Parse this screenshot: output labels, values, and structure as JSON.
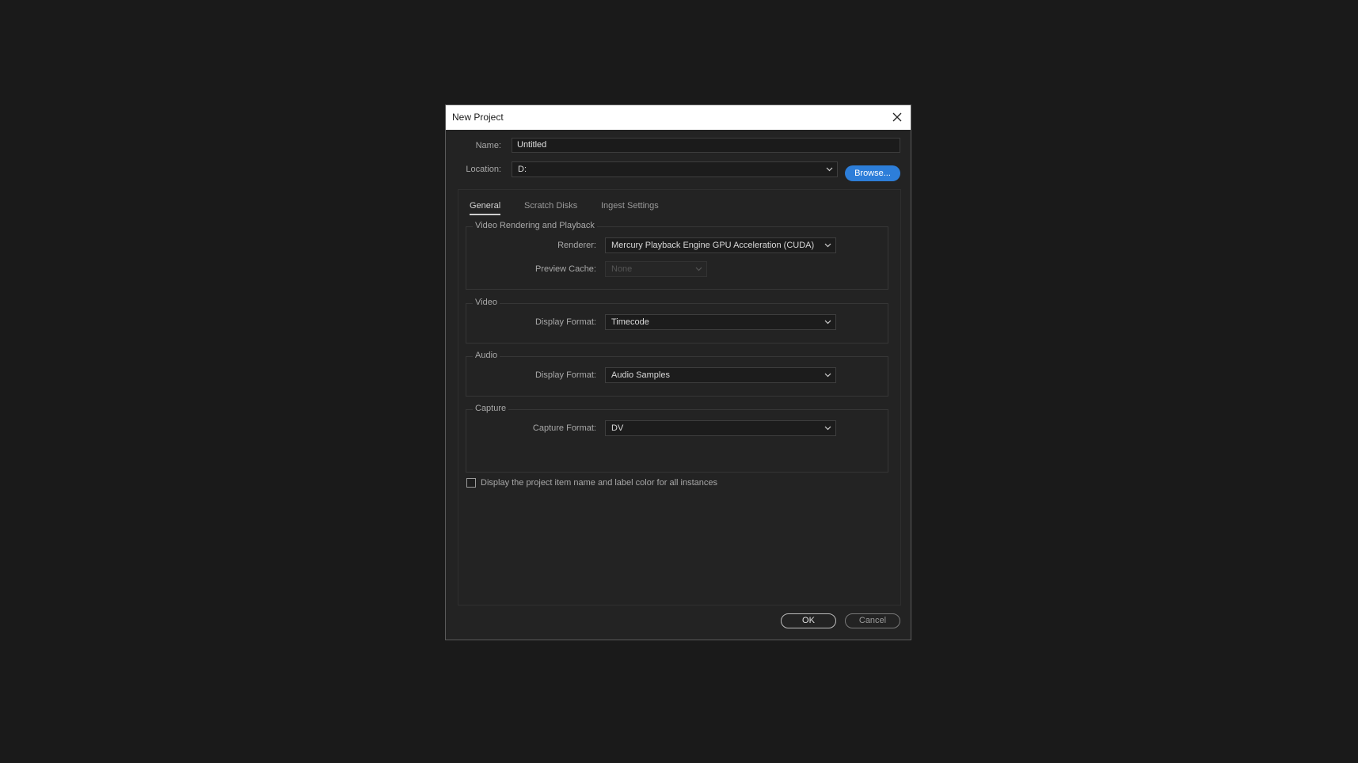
{
  "dialog": {
    "title": "New Project",
    "close_icon": "close-icon"
  },
  "name": {
    "label": "Name:",
    "value": "Untitled"
  },
  "location": {
    "label": "Location:",
    "value": "D:",
    "browse_label": "Browse..."
  },
  "tabs": [
    {
      "label": "General",
      "active": true
    },
    {
      "label": "Scratch Disks",
      "active": false
    },
    {
      "label": "Ingest Settings",
      "active": false
    }
  ],
  "video_rendering": {
    "title": "Video Rendering and Playback",
    "renderer_label": "Renderer:",
    "renderer_value": "Mercury Playback Engine GPU Acceleration (CUDA)",
    "preview_cache_label": "Preview Cache:",
    "preview_cache_value": "None"
  },
  "video": {
    "title": "Video",
    "display_format_label": "Display Format:",
    "display_format_value": "Timecode"
  },
  "audio": {
    "title": "Audio",
    "display_format_label": "Display Format:",
    "display_format_value": "Audio Samples"
  },
  "capture": {
    "title": "Capture",
    "capture_format_label": "Capture Format:",
    "capture_format_value": "DV"
  },
  "checkbox": {
    "label": "Display the project item name and label color for all instances",
    "checked": false
  },
  "buttons": {
    "ok": "OK",
    "cancel": "Cancel"
  },
  "colors": {
    "accent": "#2d7ed9",
    "background": "#1a1a1a",
    "dialog": "#232323"
  }
}
